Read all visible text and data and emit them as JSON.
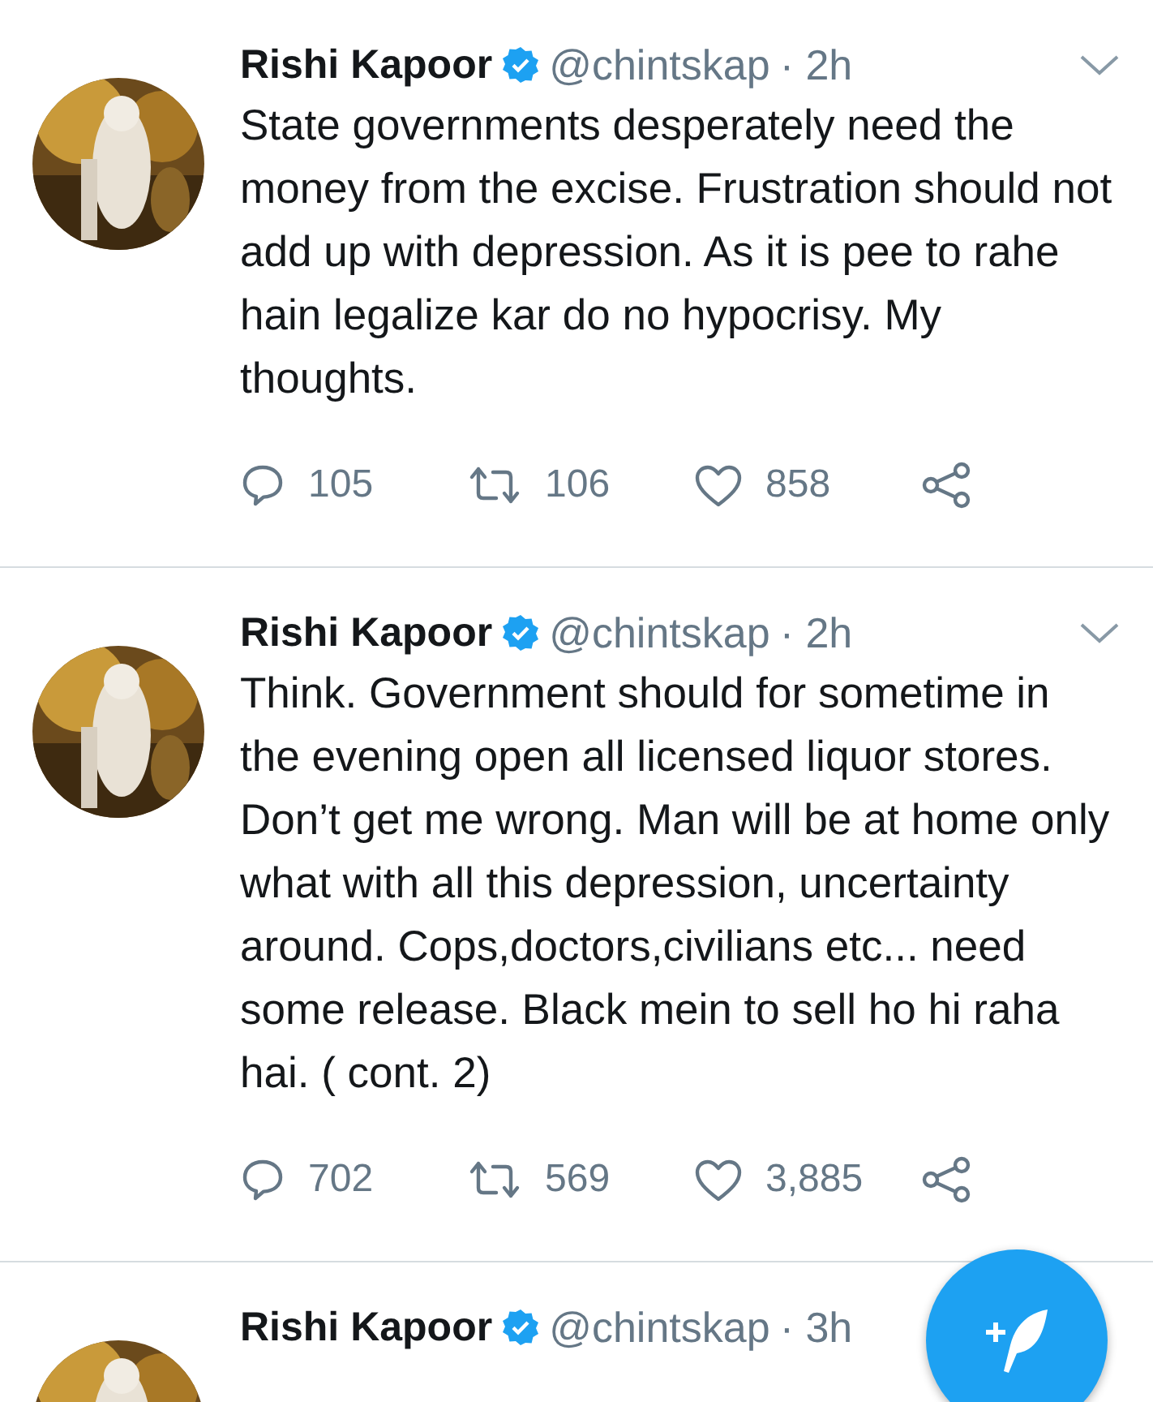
{
  "tweets": [
    {
      "name": "Rishi Kapoor",
      "verified": true,
      "handle": "@chintskap",
      "time": "· 2h",
      "menu": true,
      "text": "State governments desperately need the money from the excise. Frustration should not add up with depression. As it is pee to rahe hain legalize kar do no hypocrisy. My thoughts.",
      "replies": "105",
      "retweets": "106",
      "likes": "858"
    },
    {
      "name": "Rishi Kapoor",
      "verified": true,
      "handle": "@chintskap",
      "time": "· 2h",
      "menu": true,
      "text": "Think. Government should for sometime in the evening open all licensed liquor stores. Don’t get me wrong. Man will be at home only what with all this depression, uncertainty around. Cops,doctors,civilians etc... need some release. Black mein to sell ho hi raha hai. ( cont. 2)",
      "replies": "702",
      "retweets": "569",
      "likes": "3,885"
    },
    {
      "name": "Rishi Kapoor",
      "verified": true,
      "handle": "@chintskap",
      "time": "· 3h"
    }
  ]
}
